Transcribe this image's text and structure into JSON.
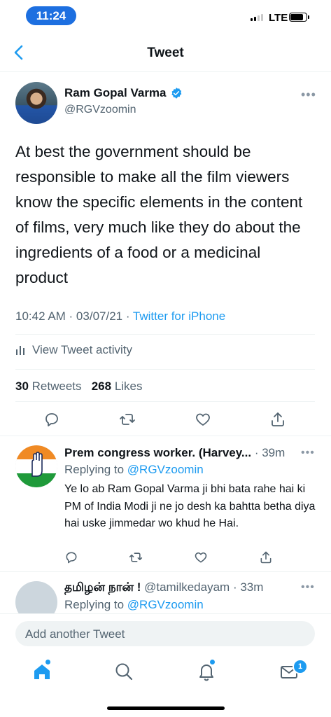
{
  "status_bar": {
    "time": "11:24",
    "network": "LTE"
  },
  "nav": {
    "title": "Tweet"
  },
  "tweet": {
    "author_name": "Ram Gopal Varma",
    "author_handle": "@RGVzoomin",
    "text": "At best the government should be responsible to make all the film viewers know the specific elements in the content of films, very much like they do about the ingredients of a food or a medicinal product",
    "timestamp": "10:42 AM · 03/07/21 · ",
    "source": "Twitter for iPhone",
    "activity_label": "View Tweet activity",
    "retweets_count": "30",
    "retweets_label": "Retweets",
    "likes_count": "268",
    "likes_label": "Likes"
  },
  "replies": [
    {
      "name": "Prem congress worker. (Harvey...",
      "time": " · 39m",
      "replying_prefix": "Replying to ",
      "replying_handle": "@RGVzoomin",
      "text": "Ye lo ab Ram Gopal Varma ji bhi bata rahe hai ki PM of India Modi ji ne jo desh ka bahtta betha diya hai uske jimmedar wo khud he Hai."
    },
    {
      "name": "தமிழன் நான் !",
      "handle": " @tamilkedayam",
      "time": " · 33m",
      "replying_prefix": "Replying to ",
      "replying_handle": "@RGVzoomin"
    }
  ],
  "compose": {
    "placeholder": "Add another Tweet"
  },
  "tabbar": {
    "messages_badge": "1"
  },
  "colors": {
    "accent": "#1d9bf0",
    "time_pill": "#1d6fe0",
    "secondary_text": "#536471"
  }
}
